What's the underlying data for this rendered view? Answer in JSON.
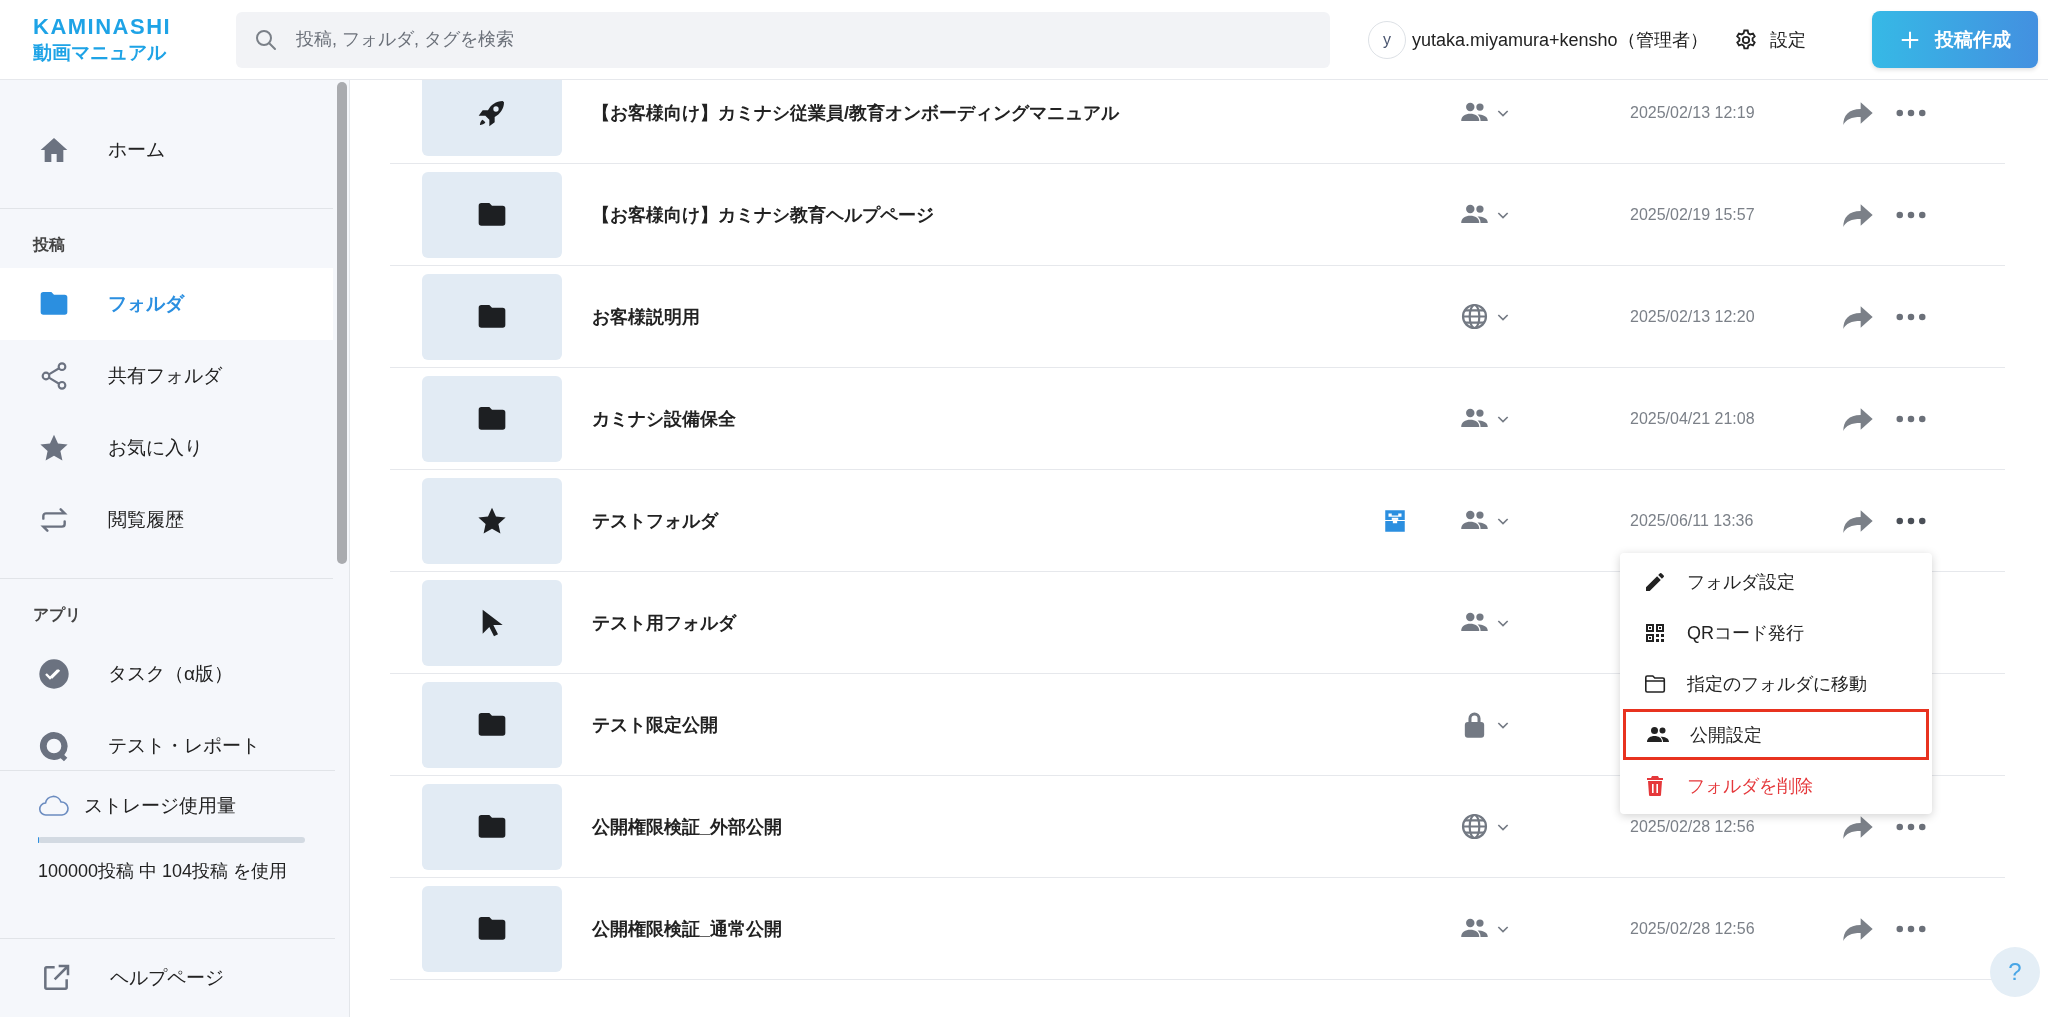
{
  "header": {
    "logo_top": "KAMINASHI",
    "logo_bottom": "動画マニュアル",
    "search": {
      "placeholder": "投稿, フォルダ, タグを検索"
    },
    "user": {
      "initial": "y",
      "name": "yutaka.miyamura+kensho（管理者）"
    },
    "settings": "設定",
    "create_button": "投稿作成"
  },
  "sidebar": {
    "sections": [
      {
        "items": [
          {
            "kind": "home",
            "label": "ホーム",
            "selected": false
          }
        ]
      },
      {
        "title": "投稿",
        "items": [
          {
            "kind": "folder",
            "label": "フォルダ",
            "selected": true
          },
          {
            "kind": "share",
            "label": "共有フォルダ",
            "selected": false
          },
          {
            "kind": "star",
            "label": "お気に入り",
            "selected": false
          },
          {
            "kind": "repeat",
            "label": "閲覧履歴",
            "selected": false
          }
        ]
      },
      {
        "title": "アプリ",
        "items": [
          {
            "kind": "task",
            "label": "タスク（α版）",
            "selected": false
          },
          {
            "kind": "quiz",
            "label": "テスト・レポート",
            "selected": false
          }
        ]
      }
    ],
    "storage": {
      "label": "ストレージ使用量",
      "level": 0.001,
      "usage": "100000投稿 中 104投稿 を使用"
    },
    "help": "ヘルプページ"
  },
  "folders": [
    {
      "kind": "rocket",
      "name": "【お客様向け】カミナシ従業員/教育オンボーディングマニュアル",
      "access": {
        "kind": "members"
      },
      "badge": false,
      "date": "2025/02/13 12:19"
    },
    {
      "kind": "folder",
      "name": "【お客様向け】カミナシ教育ヘルプページ",
      "access": {
        "kind": "members"
      },
      "badge": false,
      "date": "2025/02/19 15:57"
    },
    {
      "kind": "folder",
      "name": "お客様説明用",
      "access": {
        "kind": "public"
      },
      "badge": false,
      "date": "2025/02/13 12:20"
    },
    {
      "kind": "folder",
      "name": "カミナシ設備保全",
      "access": {
        "kind": "members"
      },
      "badge": false,
      "date": "2025/04/21 21:08"
    },
    {
      "kind": "star",
      "name": "テストフォルダ",
      "access": {
        "kind": "members"
      },
      "badge": true,
      "menu_open": true,
      "date": "2025/06/11 13:36"
    },
    {
      "kind": "cursor",
      "name": "テスト用フォルダ",
      "access": {
        "kind": "members"
      },
      "badge": false
    },
    {
      "kind": "folder",
      "name": "テスト限定公開",
      "access": {
        "kind": "private"
      },
      "badge": false
    },
    {
      "kind": "folder",
      "name": "公開権限検証_外部公開",
      "access": {
        "kind": "public"
      },
      "badge": false,
      "date": "2025/02/28 12:56"
    },
    {
      "kind": "folder",
      "name": "公開権限検証_通常公開",
      "access": {
        "kind": "members"
      },
      "badge": false,
      "date": "2025/02/28 12:56"
    }
  ],
  "context_menu": {
    "items": [
      {
        "kind": "pencil",
        "label": "フォルダ設定",
        "danger": false,
        "highlighted": false
      },
      {
        "kind": "qr",
        "label": "QRコード発行",
        "danger": false,
        "highlighted": false
      },
      {
        "kind": "folder-outline",
        "label": "指定のフォルダに移動",
        "danger": false,
        "highlighted": false
      },
      {
        "kind": "people",
        "label": "公開設定",
        "danger": false,
        "highlighted": true
      },
      {
        "kind": "trash",
        "label": "フォルダを削除",
        "danger": true,
        "highlighted": false
      }
    ]
  },
  "help_button": "?"
}
